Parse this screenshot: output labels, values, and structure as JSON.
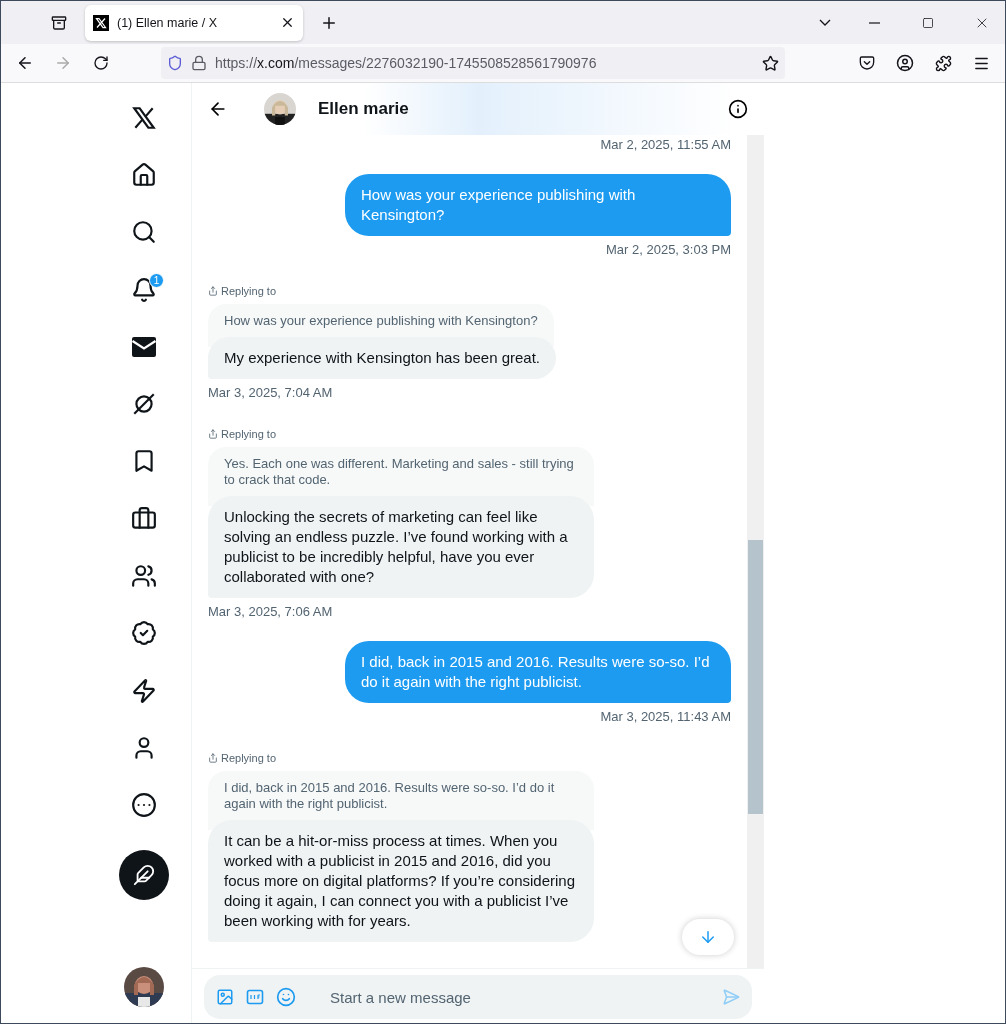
{
  "browser": {
    "tab_title": "(1) Ellen marie / X",
    "url": {
      "scheme": "https://",
      "host": "x.com",
      "path": "/messages/2276032190-1745508528561790976"
    }
  },
  "sidebar": {
    "items": [
      {
        "selected": false
      },
      {
        "selected": false
      },
      {
        "selected": false,
        "badge": "1"
      },
      {
        "selected": true
      },
      {
        "selected": false
      },
      {
        "selected": false
      },
      {
        "selected": false
      },
      {
        "selected": false
      },
      {
        "selected": false
      },
      {
        "selected": false
      },
      {
        "selected": false
      },
      {
        "selected": false
      }
    ]
  },
  "conversation": {
    "name": "Ellen marie",
    "messages": [
      {
        "kind": "time",
        "time": "Mar 2, 2025, 11:55 AM"
      },
      {
        "kind": "sent",
        "text": "How was your experience publishing with Kensington?",
        "time": "Mar 2, 2025, 3:03 PM"
      },
      {
        "kind": "received",
        "replying": "Replying to",
        "quoted": "How was your experience publishing with Kensington?",
        "text": "My experience with Kensington has been great.",
        "time": "Mar 3, 2025, 7:04 AM"
      },
      {
        "kind": "received",
        "replying": "Replying to",
        "quoted": "Yes. Each one was different. Marketing and sales - still trying to crack that code.",
        "text": "Unlocking the secrets of marketing can feel like solving an endless puzzle. I’ve found working with a publicist to be incredibly helpful, have you ever collaborated with one?",
        "time": "Mar 3, 2025, 7:06 AM"
      },
      {
        "kind": "sent",
        "text": "I did, back in 2015 and 2016. Results were so-so. I’d do it again with the right publicist.",
        "time": "Mar 3, 2025, 11:43 AM"
      },
      {
        "kind": "received",
        "replying": "Replying to",
        "quoted": "I did, back in 2015 and 2016. Results were so-so. I’d do it again with the right publicist.",
        "text": "It can be a hit-or-miss process at times. When you worked with a publicist in 2015 and 2016, did you focus more on digital platforms? If you’re considering doing it again, I can connect you with a publicist I’ve been working with for years."
      }
    ],
    "composer": {
      "placeholder": "Start a new message"
    }
  }
}
